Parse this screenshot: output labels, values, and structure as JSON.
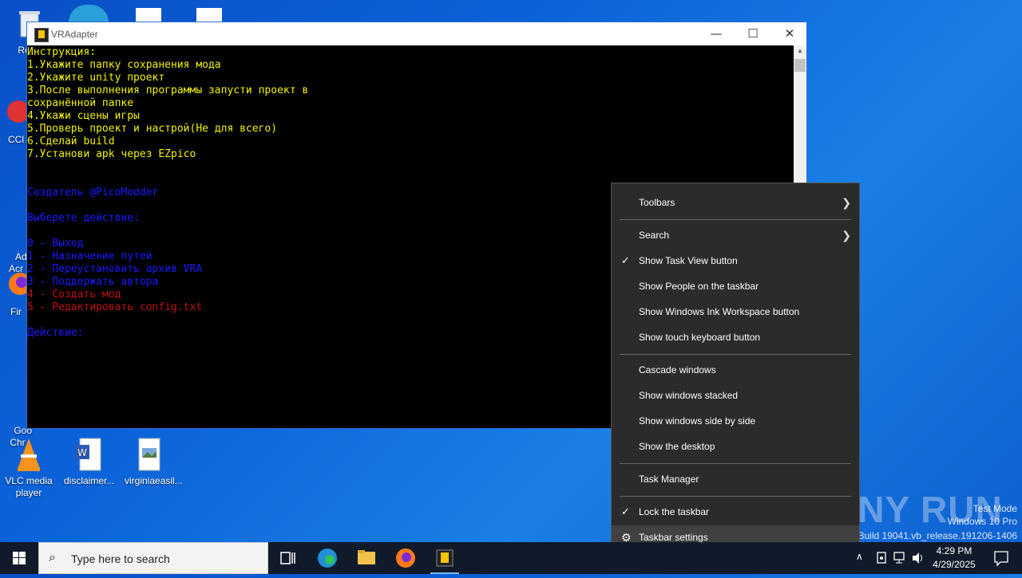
{
  "desktop": {
    "icons": [
      {
        "label": "Recy",
        "name": "recycle-bin"
      },
      {
        "label": "CCl",
        "name": "ccleaner"
      },
      {
        "label": "Ad\nAcr",
        "name": "adobe-acrobat"
      },
      {
        "label": "Fir",
        "name": "firefox"
      },
      {
        "label": "Goo\nChr",
        "name": "google-chrome"
      },
      {
        "label": "VLC media player",
        "name": "vlc"
      },
      {
        "label": "disclaimer...",
        "name": "disclaimer-doc"
      },
      {
        "label": "virginiaeasil...",
        "name": "virginia-image"
      }
    ]
  },
  "console": {
    "title": "VRAdapter",
    "controls": {
      "minimize": "—",
      "maximize": "☐",
      "close": "✕"
    },
    "lines": [
      {
        "text": "Инструкция:",
        "color": "yellow"
      },
      {
        "text": "1.Укажите папку сохранения мода",
        "color": "yellow"
      },
      {
        "text": "2.Укажите unity проект",
        "color": "yellow"
      },
      {
        "text": "3.После выполнения программы запусти проект в",
        "color": "yellow"
      },
      {
        "text": "сохранённой папке",
        "color": "yellow"
      },
      {
        "text": "4.Укажи сцены игры",
        "color": "yellow"
      },
      {
        "text": "5.Проверь проект и настрой(Не для всего)",
        "color": "yellow"
      },
      {
        "text": "6.Сделай build",
        "color": "yellow"
      },
      {
        "text": "7.Установи apk через EZpico",
        "color": "yellow"
      },
      {
        "text": "",
        "color": "yellow"
      },
      {
        "text": "",
        "color": "yellow"
      },
      {
        "text": "Создатель @PicoModder",
        "color": "blue"
      },
      {
        "text": "",
        "color": "blue"
      },
      {
        "text": "Выберете действие:",
        "color": "blue"
      },
      {
        "text": "",
        "color": "blue"
      },
      {
        "text": "0 - Выход",
        "color": "blue"
      },
      {
        "text": "1 - Назначение путей",
        "color": "blue"
      },
      {
        "text": "2 - Переустановить архив VRA",
        "color": "blue"
      },
      {
        "text": "3 - Поддержать автора",
        "color": "blue"
      },
      {
        "text": "4 - Создать мод",
        "color": "red"
      },
      {
        "text": "5 - Редактировать config.txt",
        "color": "red"
      },
      {
        "text": "",
        "color": "blue"
      },
      {
        "text": "Действие:",
        "color": "blue"
      }
    ]
  },
  "context_menu": {
    "items": [
      {
        "label": "Toolbars",
        "checked": false,
        "submenu": true,
        "hover": false
      },
      {
        "label": "Search",
        "checked": false,
        "submenu": true,
        "hover": false
      },
      {
        "label": "Show Task View button",
        "checked": true,
        "submenu": false,
        "hover": false
      },
      {
        "label": "Show People on the taskbar",
        "checked": false,
        "submenu": false,
        "hover": false
      },
      {
        "label": "Show Windows Ink Workspace button",
        "checked": false,
        "submenu": false,
        "hover": false
      },
      {
        "label": "Show touch keyboard button",
        "checked": false,
        "submenu": false,
        "hover": false
      },
      {
        "label": "Cascade windows",
        "checked": false,
        "submenu": false,
        "hover": false
      },
      {
        "label": "Show windows stacked",
        "checked": false,
        "submenu": false,
        "hover": false
      },
      {
        "label": "Show windows side by side",
        "checked": false,
        "submenu": false,
        "hover": false
      },
      {
        "label": "Show the desktop",
        "checked": false,
        "submenu": false,
        "hover": false
      },
      {
        "label": "Task Manager",
        "checked": false,
        "submenu": false,
        "hover": false
      },
      {
        "label": "Lock the taskbar",
        "checked": true,
        "submenu": false,
        "hover": false
      },
      {
        "label": "Taskbar settings",
        "checked": false,
        "submenu": false,
        "hover": true,
        "icon": "gear-icon"
      }
    ]
  },
  "watermark": {
    "brand": "ANY RUN",
    "test_mode": "Test Mode",
    "edition": "Windows 10 Pro",
    "build": "Build 19041.vb_release.191206-1406"
  },
  "taskbar": {
    "search_placeholder": "Type here to search",
    "time": "4:29 PM",
    "date": "4/29/2025"
  },
  "colors": {
    "yellow": "#f2f200",
    "blue": "#1a1aff",
    "red": "#c01010",
    "menu_bg": "#2b2b2b",
    "taskbar_bg": "#101a2a"
  }
}
